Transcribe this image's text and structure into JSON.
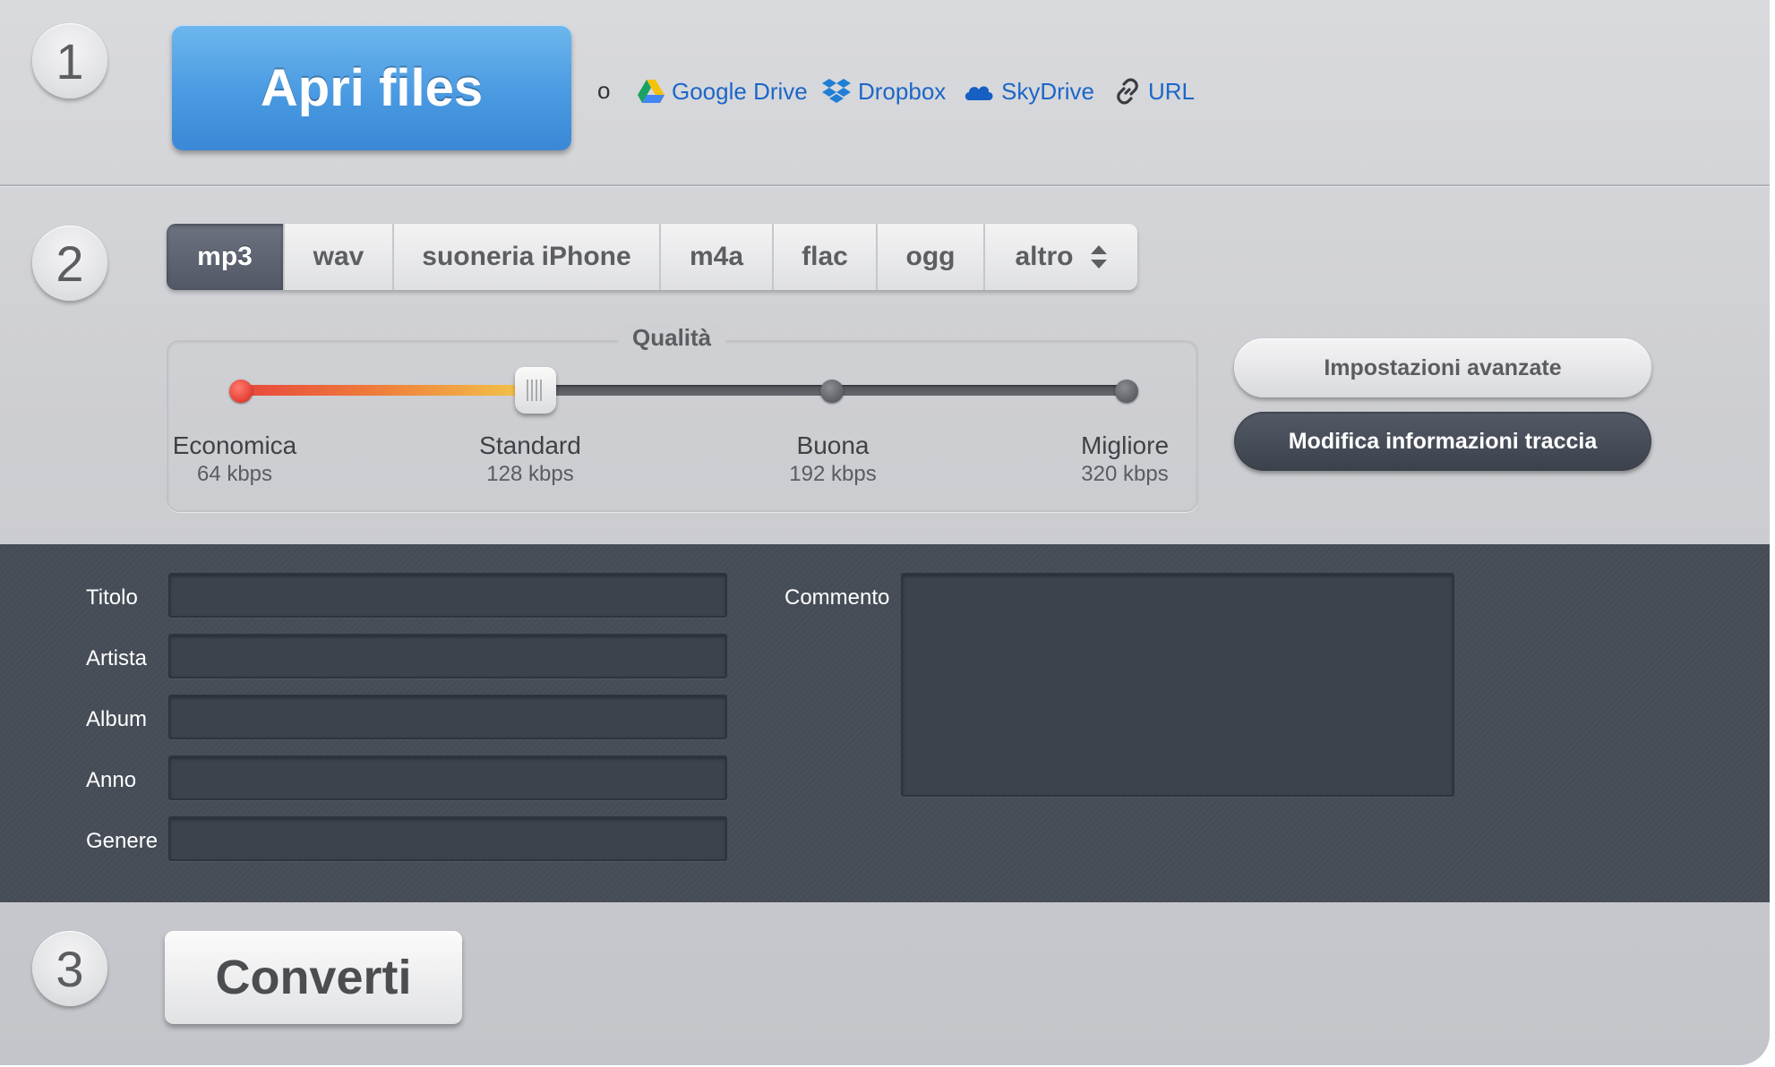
{
  "steps": {
    "one": "1",
    "two": "2",
    "three": "3"
  },
  "open": {
    "button_label": "Apri files",
    "or_text": "o",
    "sources": [
      {
        "label": "Google Drive",
        "icon": "google-drive-icon"
      },
      {
        "label": "Dropbox",
        "icon": "dropbox-icon"
      },
      {
        "label": "SkyDrive",
        "icon": "skydrive-icon"
      },
      {
        "label": "URL",
        "icon": "link-icon"
      }
    ]
  },
  "formats": {
    "tabs": [
      "mp3",
      "wav",
      "suoneria iPhone",
      "m4a",
      "flac",
      "ogg",
      "altro"
    ],
    "selected": "mp3"
  },
  "quality": {
    "title": "Qualità",
    "value_fraction": 0.333,
    "levels": [
      {
        "name": "Economica",
        "rate": "64 kbps"
      },
      {
        "name": "Standard",
        "rate": "128 kbps"
      },
      {
        "name": "Buona",
        "rate": "192 kbps"
      },
      {
        "name": "Migliore",
        "rate": "320 kbps"
      }
    ]
  },
  "settings": {
    "advanced_label": "Impostazioni avanzate",
    "edit_meta_label": "Modifica informazioni traccia"
  },
  "metadata": {
    "fields": [
      {
        "label": "Titolo",
        "value": ""
      },
      {
        "label": "Artista",
        "value": ""
      },
      {
        "label": "Album",
        "value": ""
      },
      {
        "label": "Anno",
        "value": ""
      },
      {
        "label": "Genere",
        "value": ""
      }
    ],
    "comment_label": "Commento",
    "comment_value": ""
  },
  "convert": {
    "button_label": "Converti"
  },
  "colors": {
    "accent_blue": "#4a9ae2",
    "link_blue": "#1c66c9",
    "dark_panel": "#454c56",
    "slider_start": "#e8473d",
    "slider_end": "#f2c94a"
  }
}
